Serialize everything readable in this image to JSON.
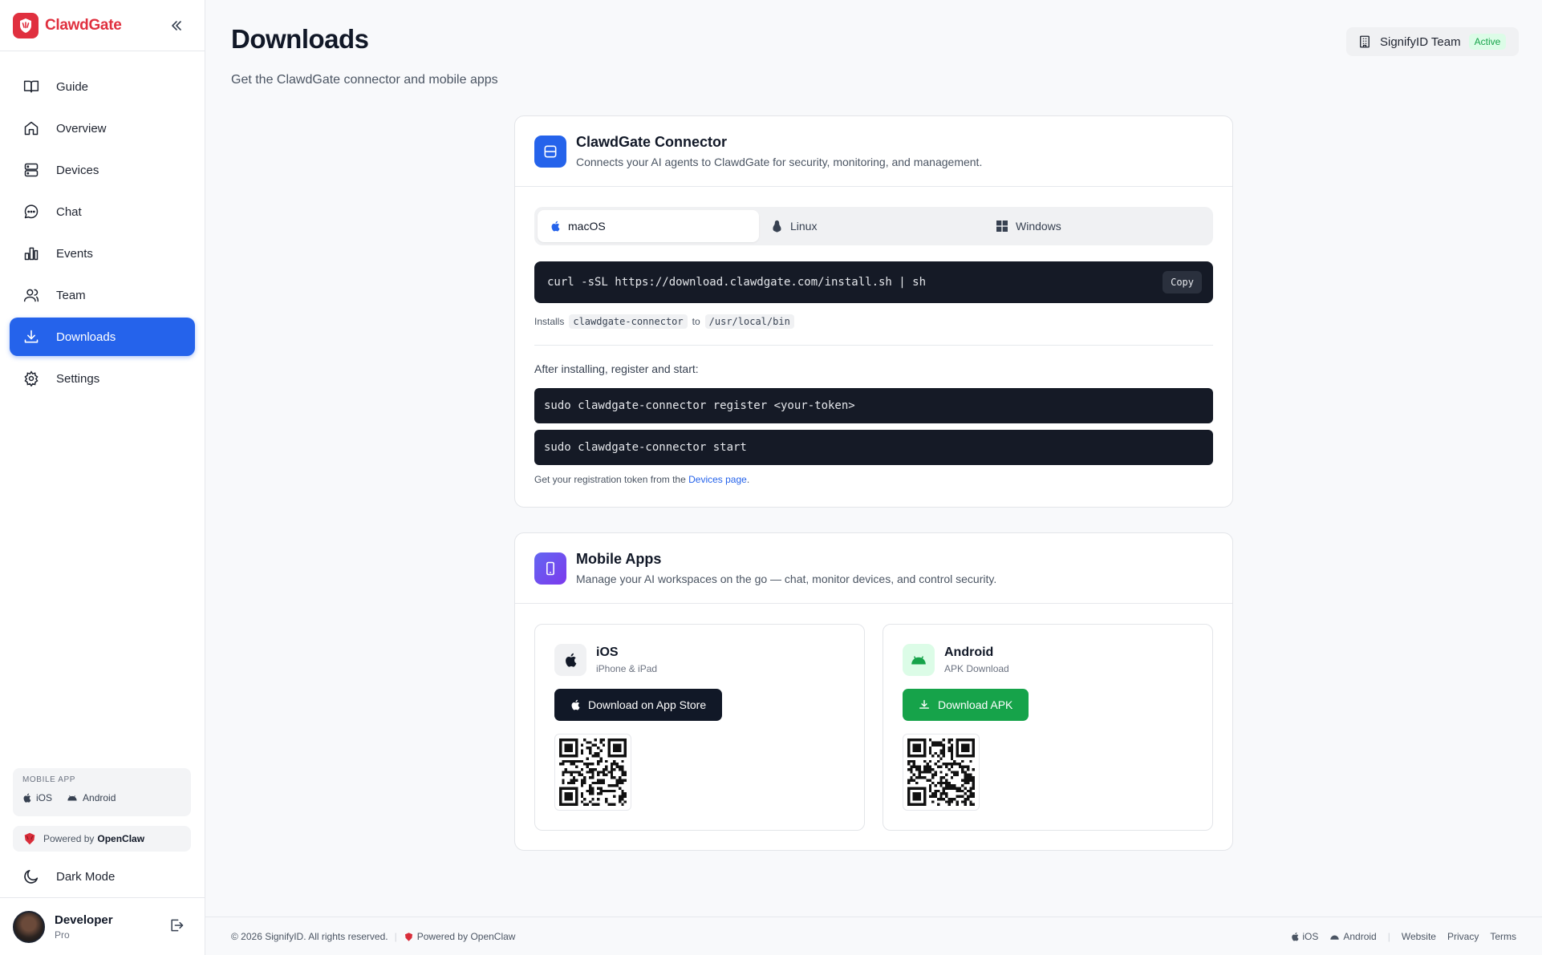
{
  "app": {
    "name": "ClawdGate",
    "brand_color": "#e0303f",
    "accent_color": "#2563eb"
  },
  "sidebar": {
    "items": [
      {
        "label": "Guide",
        "icon": "book-icon"
      },
      {
        "label": "Overview",
        "icon": "home-icon"
      },
      {
        "label": "Devices",
        "icon": "server-icon"
      },
      {
        "label": "Chat",
        "icon": "chat-icon"
      },
      {
        "label": "Events",
        "icon": "bar-chart-icon"
      },
      {
        "label": "Team",
        "icon": "users-icon"
      },
      {
        "label": "Downloads",
        "icon": "download-icon",
        "active": true
      },
      {
        "label": "Settings",
        "icon": "gear-icon"
      }
    ],
    "mobile_app": {
      "caption": "MOBILE APP",
      "ios": "iOS",
      "android": "Android"
    },
    "powered_prefix": "Powered by",
    "powered_brand": "OpenClaw",
    "dark_mode": "Dark Mode",
    "user": {
      "name": "Developer",
      "role": "Pro"
    }
  },
  "header": {
    "title": "Downloads",
    "subtitle": "Get the ClawdGate connector and mobile apps",
    "team": {
      "name": "SignifyID Team",
      "status": "Active"
    }
  },
  "connector": {
    "title": "ClawdGate Connector",
    "description": "Connects your AI agents to ClawdGate for security, monitoring, and management.",
    "tabs": [
      {
        "label": "macOS",
        "icon": "apple-icon",
        "selected": true
      },
      {
        "label": "Linux",
        "icon": "linux-icon"
      },
      {
        "label": "Windows",
        "icon": "windows-icon"
      }
    ],
    "install_command": "curl -sSL https://download.clawdgate.com/install.sh | sh",
    "copy_label": "Copy",
    "installs_prefix": "Installs",
    "installs_binary": "clawdgate-connector",
    "installs_to": "to",
    "installs_path": "/usr/local/bin",
    "after_label": "After installing, register and start:",
    "register_command": "sudo clawdgate-connector register <your-token>",
    "start_command": "sudo clawdgate-connector start",
    "note_prefix": "Get your registration token from the",
    "note_link": "Devices page",
    "note_suffix": "."
  },
  "mobile": {
    "title": "Mobile Apps",
    "description": "Manage your AI workspaces on the go — chat, monitor devices, and control security.",
    "ios": {
      "name": "iOS",
      "sub": "iPhone & iPad",
      "button": "Download on App Store",
      "button_color": "#111827"
    },
    "android": {
      "name": "Android",
      "sub": "APK Download",
      "button": "Download APK",
      "button_color": "#16a34a"
    }
  },
  "footer": {
    "copyright": "© 2026 SignifyID. All rights reserved.",
    "powered": "Powered by OpenClaw",
    "ios": "iOS",
    "android": "Android",
    "links": [
      "Website",
      "Privacy",
      "Terms"
    ]
  }
}
